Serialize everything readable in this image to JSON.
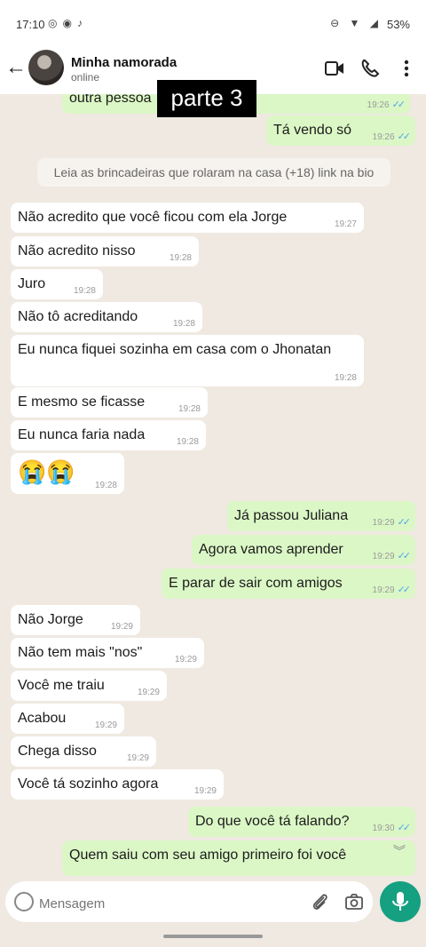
{
  "status_bar": {
    "time": "17:10",
    "battery": "53%"
  },
  "header": {
    "contact_name": "Minha namorada",
    "contact_status": "online"
  },
  "overlay_label": "parte 3",
  "notice": "Leia as brincadeiras que rolaram na casa (+18) link na bio",
  "messages": [
    {
      "text": "outra pessoa",
      "time": "19:26"
    },
    {
      "text": "Tá vendo só",
      "time": "19:26"
    },
    {
      "text": "Não acredito que você ficou com ela Jorge",
      "time": "19:27"
    },
    {
      "text": "Não acredito nisso",
      "time": "19:28"
    },
    {
      "text": "Juro",
      "time": "19:28"
    },
    {
      "text": "Não tô acreditando",
      "time": "19:28"
    },
    {
      "text": "Eu nunca fiquei sozinha em casa com o Jhonatan",
      "time": "19:28"
    },
    {
      "text": "E mesmo se ficasse",
      "time": "19:28"
    },
    {
      "text": "Eu nunca faria nada",
      "time": "19:28"
    },
    {
      "text": "😭😭",
      "time": "19:28"
    },
    {
      "text": "Já passou Juliana",
      "time": "19:29"
    },
    {
      "text": "Agora vamos aprender",
      "time": "19:29"
    },
    {
      "text": "E parar de sair com amigos",
      "time": "19:29"
    },
    {
      "text": "Não Jorge",
      "time": "19:29"
    },
    {
      "text": "Não tem mais \"nos\"",
      "time": "19:29"
    },
    {
      "text": "Você me traiu",
      "time": "19:29"
    },
    {
      "text": "Acabou",
      "time": "19:29"
    },
    {
      "text": "Chega disso",
      "time": "19:29"
    },
    {
      "text": "Você tá sozinho agora",
      "time": "19:29"
    },
    {
      "text": "Do que você tá falando?",
      "time": "19:30"
    },
    {
      "text": "Quem saiu com seu amigo primeiro foi você",
      "time": ""
    }
  ],
  "input": {
    "placeholder": "Mensagem"
  },
  "colors": {
    "outgoing_bubble": "#dbf7c6",
    "incoming_bubble": "#ffffff",
    "chat_background": "#efe9e1",
    "accent": "#15a082",
    "read_ticks": "#4fa8e6"
  }
}
